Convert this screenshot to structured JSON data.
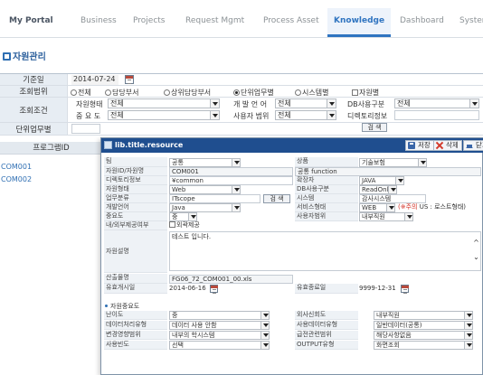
{
  "nav": {
    "tabs": [
      "My Portal",
      "Business",
      "Projects",
      "Request Mgmt",
      "Process Asset",
      "Knowledge",
      "Dashboard",
      "System"
    ],
    "active": "Knowledge",
    "accent": "#2f74c0"
  },
  "page": {
    "title": "자원관리"
  },
  "search": {
    "base_date": {
      "label": "기준일",
      "value": "2014-07-24"
    },
    "scope": {
      "label": "조회범위",
      "options": [
        "전체",
        "담당부서",
        "상위담당부서",
        "단위업무별",
        "시스템별"
      ],
      "selected": "단위업무별",
      "check_label": "자원별"
    },
    "condition": {
      "label": "조회조건",
      "resource_type": {
        "label": "자원형태",
        "value": "전체"
      },
      "dev_lang": {
        "label": "개 발 언 어",
        "value": "전체"
      },
      "db_type": {
        "label": "DB사용구분",
        "value": "전체"
      },
      "importance": {
        "label": "중 요 도",
        "value": "전체"
      },
      "user_scope": {
        "label": "사용자 범위",
        "value": "전체"
      },
      "dir_info": {
        "label": "디렉토리정보",
        "value": ""
      }
    },
    "unit_work": {
      "label": "단위업무별",
      "value": ""
    },
    "search_button": "검 색"
  },
  "program_list": {
    "header": "프로그램ID",
    "rows": [
      "COM001",
      "COM002"
    ]
  },
  "popup": {
    "title": "lib.title.resource",
    "buttons": {
      "save": "저장",
      "delete": "삭제",
      "close": "닫기"
    },
    "fields": {
      "team": {
        "label": "팀",
        "value": "공통"
      },
      "product": {
        "label": "상품",
        "value": "기술보험"
      },
      "resource_id": {
        "label": "자원ID/자원명",
        "id": "COM001",
        "name": "공통 function"
      },
      "dir_info": {
        "label": "디렉토리정보",
        "value": "¥common"
      },
      "extension": {
        "label": "확장자",
        "value": "JAVA"
      },
      "res_type": {
        "label": "자원형태",
        "value": "Web"
      },
      "db_type": {
        "label": "DB사용구분",
        "value": "ReadOnly"
      },
      "work_class": {
        "label": "업무분류",
        "value": "ITscope"
      },
      "system": {
        "label": "시스템",
        "value": "감사시스템"
      },
      "dev_lang": {
        "label": "개발언어",
        "value": "Java"
      },
      "service": {
        "label": "서비스형태",
        "value": "WEB",
        "note_prefix": "(※주의",
        "note_rest": " US : 로스트형태)"
      },
      "importance": {
        "label": "중요도",
        "value": "중"
      },
      "user_scope": {
        "label": "사용자범위",
        "value": "내부직원"
      },
      "in_out": {
        "label": "내/외부제공여부",
        "check": "외곽제공"
      },
      "description": {
        "label": "자원설명",
        "value": "테스트 입니다."
      },
      "output": {
        "label": "산출물명",
        "value": "FG06_72_COM001_00.xls"
      },
      "start_date": {
        "label": "유효개시일",
        "value": "2014-06-16"
      },
      "end_date": {
        "label": "유효종료일",
        "value": "9999-12-31"
      },
      "search_btn": "검 색"
    },
    "importance_section": {
      "title": "자원중요도",
      "rows": [
        {
          "l1": "난이도",
          "v1": "중",
          "l2": "외사신회도",
          "v2": "내부직원"
        },
        {
          "l1": "데이터처리유형",
          "v1": "데이터 사용 안함",
          "l2": "사용데이터유형",
          "v2": "일반데이터(공통)"
        },
        {
          "l1": "변경영향범위",
          "v1": "내부의 학시스템",
          "l2": "급전관련범위",
          "v2": "해당사항없음"
        },
        {
          "l1": "사용빈도",
          "v1": "선택",
          "l2": "OUTPUT유형",
          "v2": "화면조회"
        }
      ]
    }
  }
}
